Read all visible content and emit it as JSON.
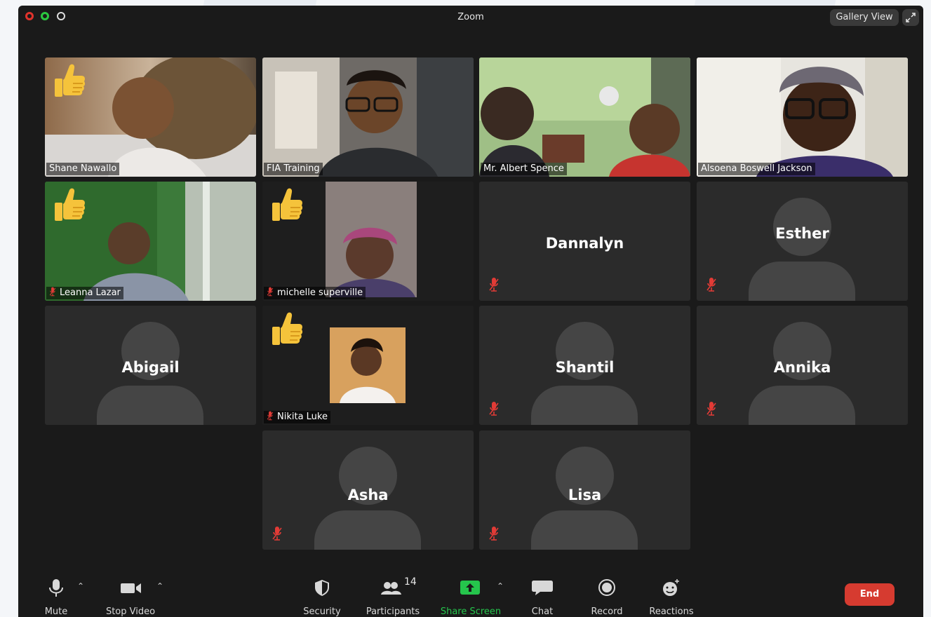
{
  "window": {
    "title": "Zoom",
    "view_button": "Gallery View"
  },
  "tiles": {
    "shane": {
      "name": "Shane Nawallo"
    },
    "fia": {
      "name": "FIA Training"
    },
    "albert": {
      "name": "Mr. Albert Spence"
    },
    "alsoena": {
      "name": "Alsoena Boswell Jackson"
    },
    "leanna": {
      "name": "Leanna Lazar"
    },
    "michelle": {
      "name": "michelle superville"
    },
    "dannalyn": {
      "name": "Dannalyn"
    },
    "esther": {
      "name": "Esther"
    },
    "abigail": {
      "name": "Abigail"
    },
    "nikita": {
      "name": "Nikita Luke"
    },
    "shantil": {
      "name": "Shantil"
    },
    "annika": {
      "name": "Annika"
    },
    "asha": {
      "name": "Asha"
    },
    "lisa": {
      "name": "Lisa"
    }
  },
  "toolbar": {
    "mute": "Mute",
    "stop_video": "Stop Video",
    "security": "Security",
    "participants": "Participants",
    "participants_count": "14",
    "share_screen": "Share Screen",
    "chat": "Chat",
    "record": "Record",
    "reactions": "Reactions",
    "end": "End"
  },
  "colors": {
    "window_bg": "#1a1a1a",
    "tile_bg": "#2b2b2b",
    "avatar": "#454545",
    "share_green": "#25c54c",
    "muted_red": "#e23b36",
    "end_red": "#d63b30",
    "close_red": "#e0332c",
    "min_green": "#2bc840",
    "thumbs_yellow": "#f5c33b"
  },
  "icons": [
    "mic-icon",
    "video-camera-icon",
    "shield-icon",
    "participants-icon",
    "share-screen-icon",
    "chat-icon",
    "record-icon",
    "reactions-icon",
    "muted-mic-icon",
    "thumbs-up-icon",
    "fullscreen-icon",
    "caret-up-icon"
  ]
}
